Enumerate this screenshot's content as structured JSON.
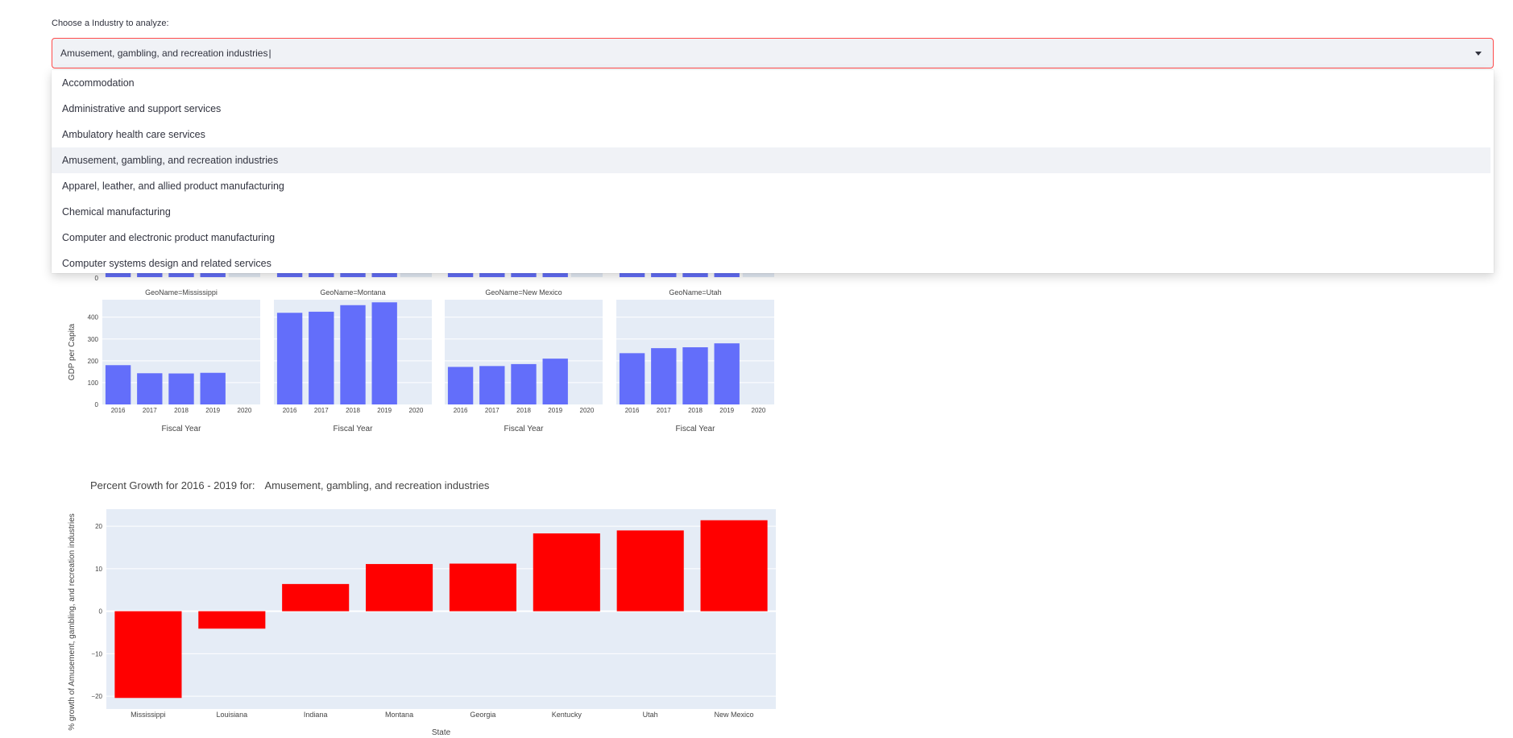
{
  "select": {
    "label": "Choose a Industry to analyze:",
    "value": "Amusement, gambling, and recreation industries",
    "options": [
      "Accommodation",
      "Administrative and support services",
      "Ambulatory health care services",
      "Amusement, gambling, and recreation industries",
      "Apparel, leather, and allied product manufacturing",
      "Chemical manufacturing",
      "Computer and electronic product manufacturing",
      "Computer systems design and related services"
    ],
    "selected_index": 3
  },
  "colors": {
    "accent": "#ff4b4b",
    "facet_bar": "#636efa",
    "growth_bar": "#ff0000",
    "plot_bg": "#e5ecf6"
  },
  "chart_data": [
    {
      "type": "bar",
      "ylabel": "GDP per Capita",
      "xlabel": "Fiscal Year",
      "categories": [
        "2016",
        "2017",
        "2018",
        "2019",
        "2020"
      ],
      "ylim": [
        0,
        480
      ],
      "yticks": [
        0,
        100,
        200,
        300,
        400
      ],
      "facets": [
        {
          "title": "GeoName=Mississippi",
          "values": [
            180,
            143,
            142,
            145,
            null
          ]
        },
        {
          "title": "GeoName=Montana",
          "values": [
            420,
            425,
            455,
            468,
            null
          ]
        },
        {
          "title": "GeoName=New Mexico",
          "values": [
            172,
            176,
            185,
            210,
            null
          ]
        },
        {
          "title": "GeoName=Utah",
          "values": [
            235,
            258,
            262,
            280,
            null
          ]
        }
      ]
    },
    {
      "type": "bar",
      "title_prefix": "Percent Growth for 2016 - 2019 for:",
      "title_industry": "Amusement, gambling, and recreation industries",
      "ylabel": "% growth of   Amusement, gambling, and recreation industries",
      "xlabel": "State",
      "categories": [
        "Mississippi",
        "Louisiana",
        "Indiana",
        "Montana",
        "Georgia",
        "Kentucky",
        "Utah",
        "New Mexico"
      ],
      "values": [
        -20.4,
        -4.1,
        6.4,
        11.1,
        11.2,
        18.3,
        19.0,
        21.4
      ],
      "ylim": [
        -23,
        24
      ],
      "yticks": [
        -20,
        -10,
        0,
        10,
        20
      ]
    }
  ]
}
